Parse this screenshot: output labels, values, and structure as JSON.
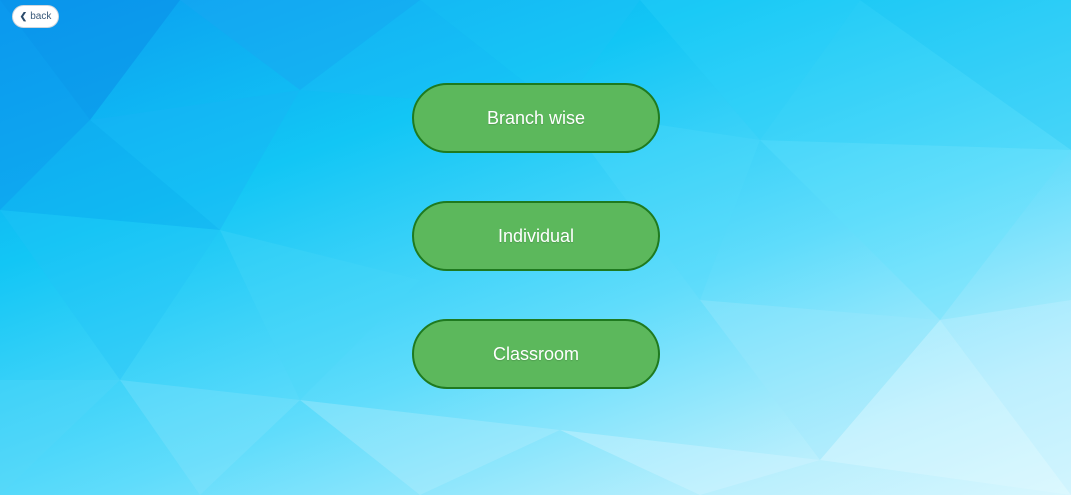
{
  "nav": {
    "back_label": "back",
    "back_icon": "chevron-left-icon"
  },
  "menu": {
    "items": [
      {
        "label": "Branch wise"
      },
      {
        "label": "Individual"
      },
      {
        "label": "Classroom"
      }
    ]
  },
  "colors": {
    "button_fill": "#5cb85c",
    "button_border": "#1f7a1f",
    "background_top": "#0a9cf0",
    "background_bottom": "#d8f7fe"
  }
}
